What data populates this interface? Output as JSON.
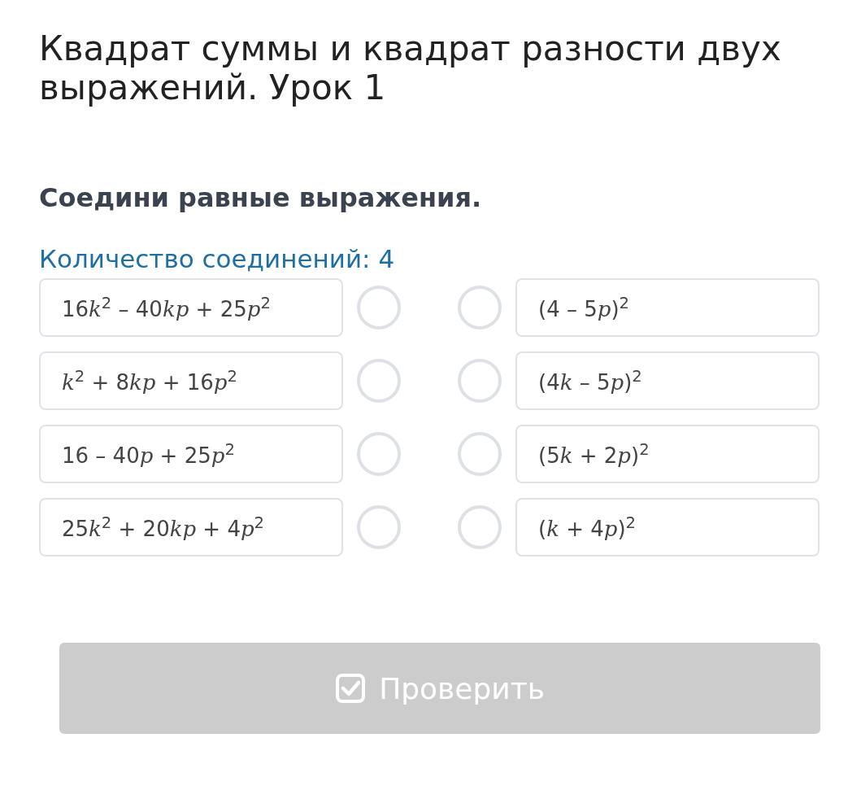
{
  "title": "Квадрат суммы и квадрат разности двух выражений. Урок 1",
  "instruction": "Соедини равные выражения.",
  "connections_count": "Количество соединений: 4",
  "left": [
    [
      {
        "kind": "text",
        "s": "16"
      },
      {
        "kind": "var",
        "s": "k"
      },
      {
        "kind": "sup",
        "s": "2"
      },
      {
        "kind": "text",
        "s": " – 40"
      },
      {
        "kind": "var",
        "s": "kp"
      },
      {
        "kind": "text",
        "s": " + 25"
      },
      {
        "kind": "var",
        "s": "p"
      },
      {
        "kind": "sup",
        "s": "2"
      }
    ],
    [
      {
        "kind": "var",
        "s": "k"
      },
      {
        "kind": "sup",
        "s": "2"
      },
      {
        "kind": "text",
        "s": " + 8"
      },
      {
        "kind": "var",
        "s": "kp"
      },
      {
        "kind": "text",
        "s": " + 16"
      },
      {
        "kind": "var",
        "s": "p"
      },
      {
        "kind": "sup",
        "s": "2"
      }
    ],
    [
      {
        "kind": "text",
        "s": "16 – 40"
      },
      {
        "kind": "var",
        "s": "p"
      },
      {
        "kind": "text",
        "s": " + 25"
      },
      {
        "kind": "var",
        "s": "p"
      },
      {
        "kind": "sup",
        "s": "2"
      }
    ],
    [
      {
        "kind": "text",
        "s": "25"
      },
      {
        "kind": "var",
        "s": "k"
      },
      {
        "kind": "sup",
        "s": "2"
      },
      {
        "kind": "text",
        "s": " + 20"
      },
      {
        "kind": "var",
        "s": "kp"
      },
      {
        "kind": "text",
        "s": " + 4"
      },
      {
        "kind": "var",
        "s": "p"
      },
      {
        "kind": "sup",
        "s": "2"
      }
    ]
  ],
  "right": [
    [
      {
        "kind": "text",
        "s": "(4 – 5"
      },
      {
        "kind": "var",
        "s": "p"
      },
      {
        "kind": "text",
        "s": ")"
      },
      {
        "kind": "sup",
        "s": "2"
      }
    ],
    [
      {
        "kind": "text",
        "s": "(4"
      },
      {
        "kind": "var",
        "s": "k"
      },
      {
        "kind": "text",
        "s": " – 5"
      },
      {
        "kind": "var",
        "s": "p"
      },
      {
        "kind": "text",
        "s": ")"
      },
      {
        "kind": "sup",
        "s": "2"
      }
    ],
    [
      {
        "kind": "text",
        "s": "(5"
      },
      {
        "kind": "var",
        "s": "k"
      },
      {
        "kind": "text",
        "s": " + 2"
      },
      {
        "kind": "var",
        "s": "p"
      },
      {
        "kind": "text",
        "s": ")"
      },
      {
        "kind": "sup",
        "s": "2"
      }
    ],
    [
      {
        "kind": "text",
        "s": "("
      },
      {
        "kind": "var",
        "s": "k"
      },
      {
        "kind": "text",
        "s": " + 4"
      },
      {
        "kind": "var",
        "s": "p"
      },
      {
        "kind": "text",
        "s": ")"
      },
      {
        "kind": "sup",
        "s": "2"
      }
    ]
  ],
  "check_button": {
    "label": "Проверить",
    "disabled": true
  }
}
